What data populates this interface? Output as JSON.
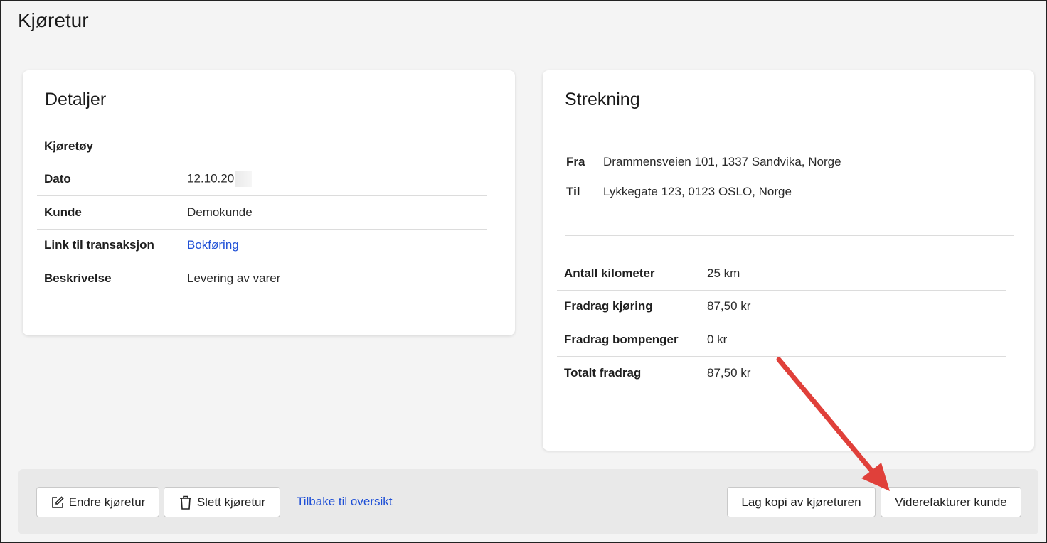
{
  "page": {
    "title": "Kjøretur"
  },
  "details": {
    "title": "Detaljer",
    "rows": [
      {
        "key": "Kjøretøy",
        "value": ""
      },
      {
        "key": "Dato",
        "value": "12.10.20"
      },
      {
        "key": "Kunde",
        "value": "Demokunde"
      },
      {
        "key": "Link til transaksjon",
        "value": "Bokføring"
      },
      {
        "key": "Beskrivelse",
        "value": "Levering av varer"
      }
    ]
  },
  "route": {
    "title": "Strekning",
    "from_label": "Fra",
    "from_value": "Drammensveien 101, 1337 Sandvika, Norge",
    "to_label": "Til",
    "to_value": "Lykkegate 123, 0123 OSLO, Norge",
    "rows": [
      {
        "key": "Antall kilometer",
        "value": "25 km"
      },
      {
        "key": "Fradrag kjøring",
        "value": "87,50 kr"
      },
      {
        "key": "Fradrag bompenger",
        "value": "0 kr"
      },
      {
        "key": "Totalt fradrag",
        "value": "87,50 kr"
      }
    ]
  },
  "actions": {
    "edit_label": "Endre kjøretur",
    "delete_label": "Slett kjøretur",
    "back_label": "Tilbake til oversikt",
    "copy_label": "Lag kopi av kjøreturen",
    "invoice_label": "Viderefakturer kunde"
  },
  "colors": {
    "link": "#1e4fd6",
    "arrow": "#e0403a"
  }
}
